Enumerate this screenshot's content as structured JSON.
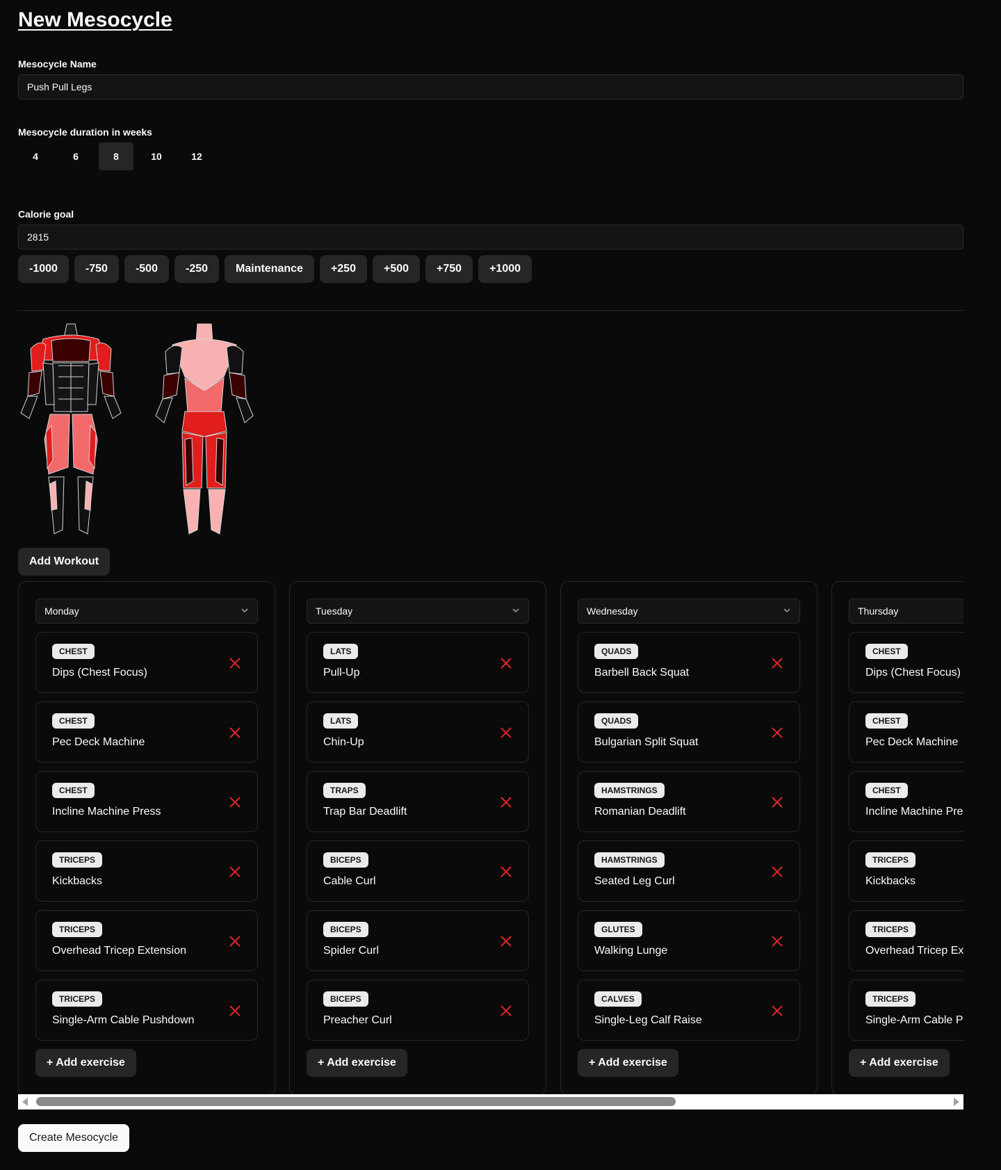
{
  "page": {
    "title": "New Mesocycle"
  },
  "form": {
    "name_label": "Mesocycle Name",
    "name_value": "Push Pull Legs",
    "duration_label": "Mesocycle duration in weeks",
    "weeks": [
      "4",
      "6",
      "8",
      "10",
      "12"
    ],
    "selected_week": "8",
    "calorie_label": "Calorie goal",
    "calorie_value": "2815",
    "calorie_adjustments": [
      "-1000",
      "-750",
      "-500",
      "-250",
      "Maintenance",
      "+250",
      "+500",
      "+750",
      "+1000"
    ]
  },
  "colors": {
    "background": "#0a0a0a",
    "muscle_high": "#e11d1d",
    "muscle_max": "#3a0000",
    "muscle_mid": "#f26a6a",
    "muscle_low": "#f9b1b1",
    "remove": "#dc2626"
  },
  "add_workout_label": "Add Workout",
  "workouts": [
    {
      "day": "Monday",
      "exercises": [
        {
          "tag": "CHEST",
          "name": "Dips (Chest Focus)"
        },
        {
          "tag": "CHEST",
          "name": "Pec Deck Machine"
        },
        {
          "tag": "CHEST",
          "name": "Incline Machine Press"
        },
        {
          "tag": "TRICEPS",
          "name": "Kickbacks"
        },
        {
          "tag": "TRICEPS",
          "name": "Overhead Tricep Extension"
        },
        {
          "tag": "TRICEPS",
          "name": "Single-Arm Cable Pushdown"
        }
      ]
    },
    {
      "day": "Tuesday",
      "exercises": [
        {
          "tag": "LATS",
          "name": "Pull-Up"
        },
        {
          "tag": "LATS",
          "name": "Chin-Up"
        },
        {
          "tag": "TRAPS",
          "name": "Trap Bar Deadlift"
        },
        {
          "tag": "BICEPS",
          "name": "Cable Curl"
        },
        {
          "tag": "BICEPS",
          "name": "Spider Curl"
        },
        {
          "tag": "BICEPS",
          "name": "Preacher Curl"
        }
      ]
    },
    {
      "day": "Wednesday",
      "exercises": [
        {
          "tag": "QUADS",
          "name": "Barbell Back Squat"
        },
        {
          "tag": "QUADS",
          "name": "Bulgarian Split Squat"
        },
        {
          "tag": "HAMSTRINGS",
          "name": "Romanian Deadlift"
        },
        {
          "tag": "HAMSTRINGS",
          "name": "Seated Leg Curl"
        },
        {
          "tag": "GLUTES",
          "name": "Walking Lunge"
        },
        {
          "tag": "CALVES",
          "name": "Single-Leg Calf Raise"
        }
      ]
    },
    {
      "day": "Thursday",
      "exercises": [
        {
          "tag": "CHEST",
          "name": "Dips (Chest Focus)"
        },
        {
          "tag": "CHEST",
          "name": "Pec Deck Machine"
        },
        {
          "tag": "CHEST",
          "name": "Incline Machine Press"
        },
        {
          "tag": "TRICEPS",
          "name": "Kickbacks"
        },
        {
          "tag": "TRICEPS",
          "name": "Overhead Tricep Extension"
        },
        {
          "tag": "TRICEPS",
          "name": "Single-Arm Cable Pushdown"
        }
      ]
    }
  ],
  "add_exercise_label": "+ Add exercise",
  "create_label": "Create Mesocycle",
  "icons": {
    "day_dropdown": "chevron-down-icon",
    "remove_exercise": "close-icon",
    "scroll_left": "scroll-left-arrow-icon",
    "scroll_right": "scroll-right-arrow-icon"
  }
}
